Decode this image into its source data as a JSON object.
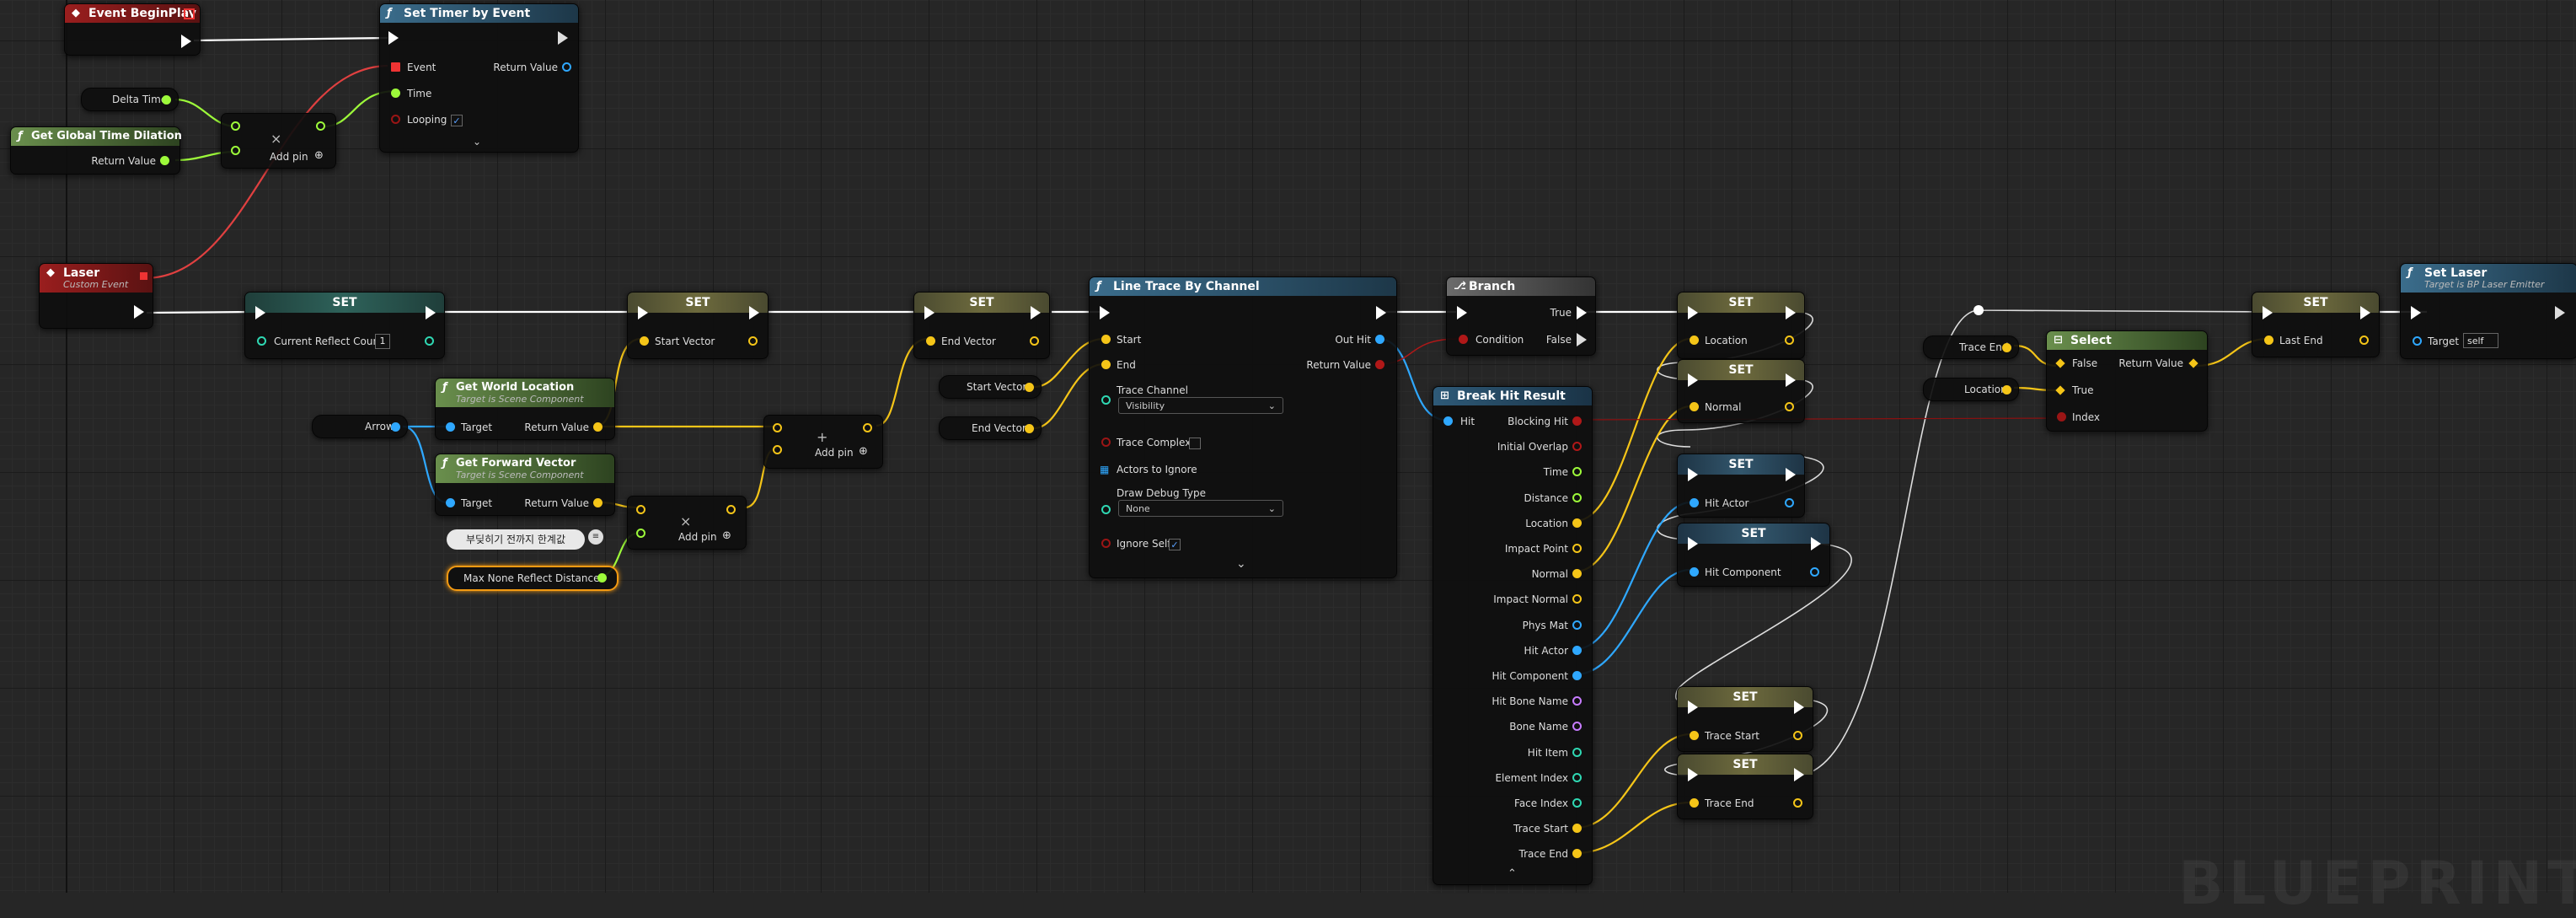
{
  "colors": {
    "exec": "#ffffff",
    "float": "#9dfa3a",
    "struct_vector": "#f5c518",
    "object": "#2fa8ff",
    "bool": "#9a1515",
    "int": "#2fd8b3",
    "name": "#c77cff",
    "string": "#e080ff",
    "material": "#cfcfcf",
    "delegate": "#ff3a3a"
  },
  "nodes": {
    "event_beginplay": {
      "title": "Event BeginPlay"
    },
    "set_timer": {
      "title": "Set Timer by Event",
      "event": "Event",
      "time": "Time",
      "looping": "Looping",
      "return_value": "Return Value"
    },
    "delta_time": {
      "label": "Delta Time"
    },
    "global_time_dilation": {
      "title": "Get Global Time Dilation",
      "return_value": "Return Value"
    },
    "multiply": {
      "symbol": "×",
      "add_pin": "Add pin"
    },
    "laser_event": {
      "title": "Laser",
      "subtitle": "Custom Event"
    },
    "set_reflect_count": {
      "title": "SET",
      "label": "Current Reflect Count",
      "value": "1"
    },
    "set_start_vector": {
      "title": "SET",
      "label": "Start Vector"
    },
    "get_world_location": {
      "title": "Get World Location",
      "subtitle": "Target is Scene Component",
      "target": "Target",
      "return_value": "Return Value"
    },
    "arrow": {
      "label": "Arrow"
    },
    "get_forward_vector": {
      "title": "Get Forward Vector",
      "subtitle": "Target is Scene Component",
      "target": "Target",
      "return_value": "Return Value"
    },
    "comment": {
      "text": "부딪히기 전까지 한계값"
    },
    "max_distance": {
      "label": "Max None Reflect Distance"
    },
    "vec_multiply": {
      "symbol": "×",
      "add_pin": "Add pin"
    },
    "vec_add": {
      "symbol": "+",
      "add_pin": "Add pin"
    },
    "set_end_vector": {
      "title": "SET",
      "label": "End Vector"
    },
    "start_vector_getter": {
      "label": "Start Vector"
    },
    "end_vector_getter": {
      "label": "End Vector"
    },
    "line_trace": {
      "title": "Line Trace By Channel",
      "start": "Start",
      "end": "End",
      "trace_channel": "Trace Channel",
      "trace_channel_value": "Visibility",
      "trace_complex": "Trace Complex",
      "actors_to_ignore": "Actors to Ignore",
      "draw_debug_type": "Draw Debug Type",
      "draw_debug_value": "None",
      "ignore_self": "Ignore Self",
      "out_hit": "Out Hit",
      "return_value": "Return Value"
    },
    "branch": {
      "title": "Branch",
      "condition": "Condition",
      "true": "True",
      "false": "False"
    },
    "break_hit": {
      "title": "Break Hit Result",
      "hit": "Hit",
      "pins": [
        "Blocking Hit",
        "Initial Overlap",
        "Time",
        "Distance",
        "Location",
        "Impact Point",
        "Normal",
        "Impact Normal",
        "Phys Mat",
        "Hit Actor",
        "Hit Component",
        "Hit Bone Name",
        "Bone Name",
        "Hit Item",
        "Element Index",
        "Face Index",
        "Trace Start",
        "Trace End"
      ]
    },
    "set_location": {
      "title": "SET",
      "label": "Location"
    },
    "set_normal": {
      "title": "SET",
      "label": "Normal"
    },
    "set_hit_actor": {
      "title": "SET",
      "label": "Hit Actor"
    },
    "set_hit_component": {
      "title": "SET",
      "label": "Hit Component"
    },
    "set_trace_start": {
      "title": "SET",
      "label": "Trace Start"
    },
    "set_trace_end": {
      "title": "SET",
      "label": "Trace End"
    },
    "trace_end_getter": {
      "label": "Trace End"
    },
    "location_getter": {
      "label": "Location"
    },
    "select": {
      "title": "Select",
      "false": "False",
      "true": "True",
      "index": "Index",
      "return_value": "Return Value"
    },
    "set_last_end": {
      "title": "SET",
      "label": "Last End"
    },
    "set_laser": {
      "title": "Set Laser",
      "subtitle": "Target is BP Laser Emitter",
      "target": "Target",
      "target_value": "self"
    }
  },
  "watermark": "BLUEPRINT"
}
